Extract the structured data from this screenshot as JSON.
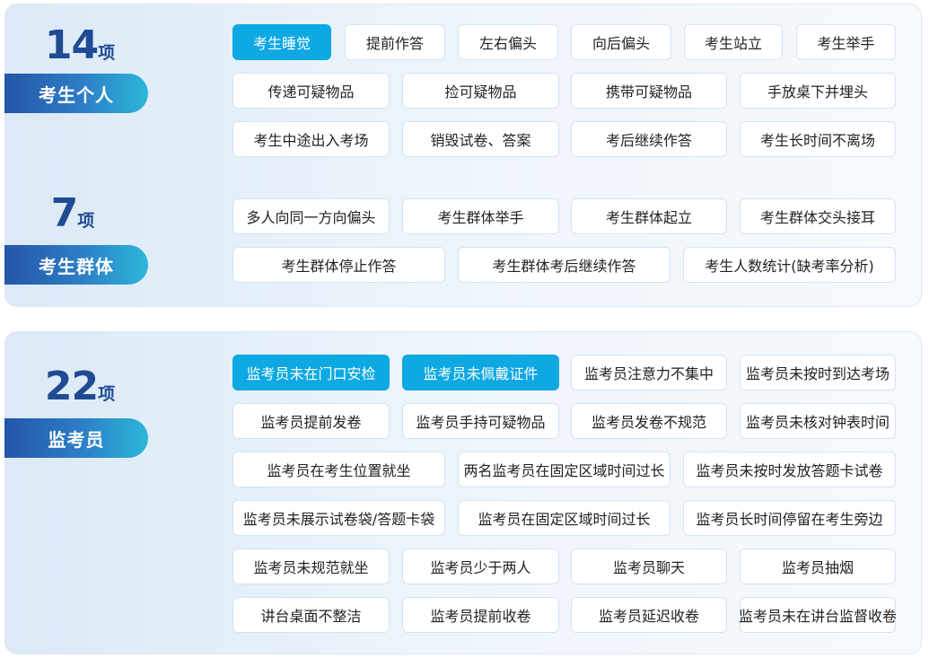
{
  "groups": [
    {
      "count": "14",
      "unit": "项",
      "label": "考生个人",
      "items": [
        "考生睡觉",
        "提前作答",
        "左右偏头",
        "向后偏头",
        "考生站立",
        "考生举手",
        "传递可疑物品",
        "捡可疑物品",
        "携带可疑物品",
        "手放桌下并埋头",
        "考生中途出入考场",
        "销毁试卷、答案",
        "考后继续作答",
        "考生长时间不离场"
      ]
    },
    {
      "count": "7",
      "unit": "项",
      "label": "考生群体",
      "items": [
        "多人向同一方向偏头",
        "考生群体举手",
        "考生群体起立",
        "考生群体交头接耳",
        "考生群体停止作答",
        "考生群体考后继续作答",
        "考生人数统计(缺考率分析)"
      ]
    },
    {
      "count": "22",
      "unit": "项",
      "label": "监考员",
      "items": [
        "监考员未在门口安检",
        "监考员未佩戴证件",
        "监考员注意力不集中",
        "监考员未按时到达考场",
        "监考员提前发卷",
        "监考员手持可疑物品",
        "监考员发卷不规范",
        "监考员未核对钟表时间",
        "监考员在考生位置就坐",
        "两名监考员在固定区域时间过长",
        "监考员未按时发放答题卡试卷",
        "监考员未展示试卷袋/答题卡袋",
        "监考员在固定区域时间过长",
        "监考员长时间停留在考生旁边",
        "监考员未规范就坐",
        "监考员少于两人",
        "监考员聊天",
        "监考员抽烟",
        "讲台桌面不整洁",
        "监考员提前收卷",
        "监考员延迟收卷",
        "监考员未在讲台监督收卷"
      ]
    }
  ],
  "highlight_color": "#0ea8e2",
  "accent_color": "#1f4b94"
}
